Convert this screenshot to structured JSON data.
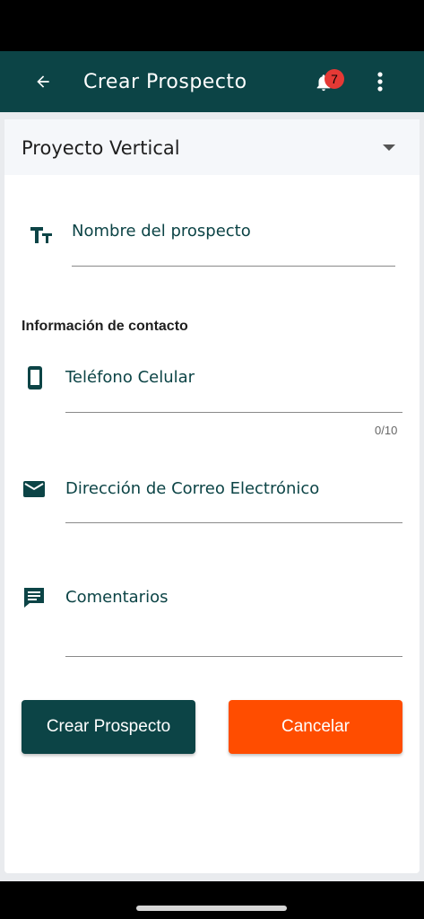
{
  "app_bar": {
    "title": "Crear Prospecto",
    "notification_count": "7",
    "bg_color": "#0c4446"
  },
  "project_select": {
    "value": "Proyecto Vertical"
  },
  "form": {
    "name_field": {
      "label": "Nombre del prospecto",
      "icon": "text-fields-icon"
    },
    "contact_section_title": "Información de contacto",
    "phone_field": {
      "label": "Teléfono Celular",
      "counter": "0/10",
      "icon": "smartphone-icon"
    },
    "email_field": {
      "label": "Dirección de Correo Electrónico",
      "icon": "mail-icon"
    },
    "comments_field": {
      "label": "Comentarios",
      "icon": "comment-icon"
    }
  },
  "actions": {
    "create_label": "Crear Prospecto",
    "cancel_label": "Cancelar",
    "create_color": "#0c4446",
    "cancel_color": "#ff4d00"
  }
}
